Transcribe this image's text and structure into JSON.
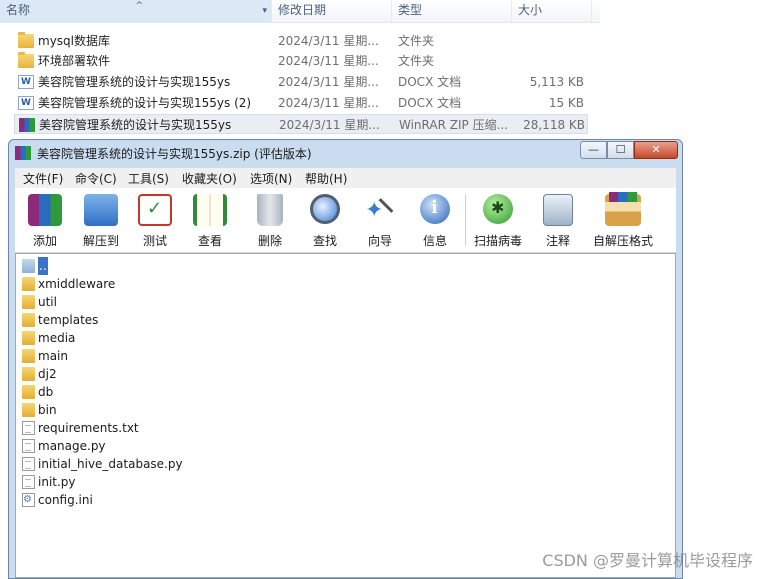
{
  "explorer": {
    "columns": {
      "name": "名称",
      "date": "修改日期",
      "type": "类型",
      "size": "大小"
    },
    "files": [
      {
        "name": "mysql数据库",
        "date": "2024/3/11 星期...",
        "type": "文件夹",
        "size": "",
        "icon": "folder-icon"
      },
      {
        "name": "环境部署软件",
        "date": "2024/3/11 星期...",
        "type": "文件夹",
        "size": "",
        "icon": "folder-icon"
      },
      {
        "name": "美容院管理系统的设计与实现155ys",
        "date": "2024/3/11 星期...",
        "type": "DOCX 文档",
        "size": "5,113 KB",
        "icon": "docx-icon"
      },
      {
        "name": "美容院管理系统的设计与实现155ys (2)",
        "date": "2024/3/11 星期...",
        "type": "DOCX 文档",
        "size": "15 KB",
        "icon": "docx-icon"
      },
      {
        "name": "美容院管理系统的设计与实现155ys",
        "date": "2024/3/11 星期...",
        "type": "WinRAR ZIP 压缩...",
        "size": "28,118 KB",
        "icon": "rar-icon"
      }
    ]
  },
  "rar": {
    "title": "美容院管理系统的设计与实现155ys.zip (评估版本)",
    "window_buttons": {
      "minimize": "—",
      "maximize": "☐",
      "close": "✕"
    },
    "menu": [
      "文件(F)",
      "命令(C)",
      "工具(S)",
      "收藏夹(O)",
      "选项(N)",
      "帮助(H)"
    ],
    "toolbar": [
      {
        "label": "添加",
        "icon": "add-icon"
      },
      {
        "label": "解压到",
        "icon": "extract-icon"
      },
      {
        "label": "测试",
        "icon": "test-icon"
      },
      {
        "label": "查看",
        "icon": "view-icon"
      },
      {
        "label": "删除",
        "icon": "delete-icon"
      },
      {
        "label": "查找",
        "icon": "find-icon"
      },
      {
        "label": "向导",
        "icon": "wizard-icon"
      },
      {
        "label": "信息",
        "icon": "info-icon"
      },
      {
        "label": "扫描病毒",
        "icon": "virus-scan-icon"
      },
      {
        "label": "注释",
        "icon": "comment-icon"
      },
      {
        "label": "自解压格式",
        "icon": "sfx-icon"
      }
    ],
    "entries": [
      {
        "name": "..",
        "kind": "up"
      },
      {
        "name": "xmiddleware",
        "kind": "folder"
      },
      {
        "name": "util",
        "kind": "folder"
      },
      {
        "name": "templates",
        "kind": "folder"
      },
      {
        "name": "media",
        "kind": "folder"
      },
      {
        "name": "main",
        "kind": "folder"
      },
      {
        "name": "dj2",
        "kind": "folder"
      },
      {
        "name": "db",
        "kind": "folder"
      },
      {
        "name": "bin",
        "kind": "folder"
      },
      {
        "name": "requirements.txt",
        "kind": "doc"
      },
      {
        "name": "manage.py",
        "kind": "doc"
      },
      {
        "name": "initial_hive_database.py",
        "kind": "doc"
      },
      {
        "name": "init.py",
        "kind": "doc"
      },
      {
        "name": "config.ini",
        "kind": "ini"
      }
    ]
  },
  "watermark": "CSDN @罗曼计算机毕设程序"
}
